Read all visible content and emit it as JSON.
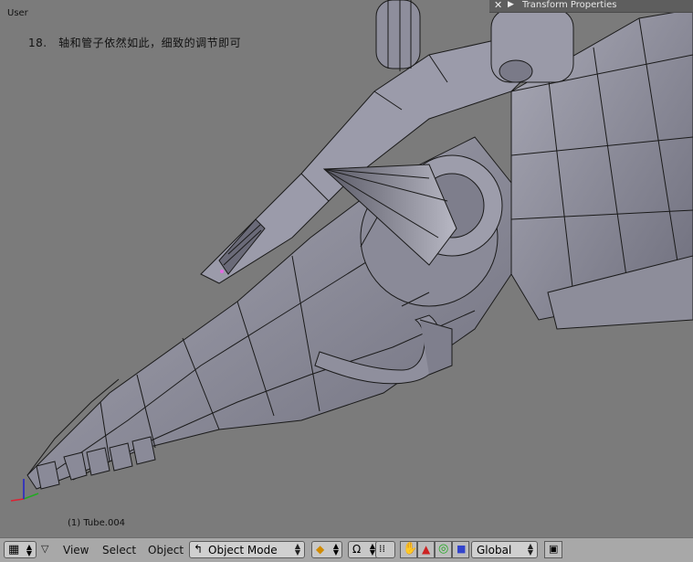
{
  "viewport": {
    "view_label": "User",
    "caption": "18.　轴和管子依然如此，细致的调节即可",
    "object_info": "(1) Tube.004"
  },
  "transform_panel": {
    "title": "Transform Properties",
    "close_icon": "close-icon",
    "collapse_icon": "triangle-right-icon"
  },
  "header": {
    "menus": [
      "View",
      "Select",
      "Object"
    ],
    "mode": "Object Mode",
    "orientation": "Global",
    "icons": [
      "grid-view-icon",
      "chevron-down-icon",
      "mode-icon",
      "shading-icon",
      "pivot-icon",
      "snap-icon",
      "hand-icon",
      "translate-icon",
      "rotate-icon",
      "scale-icon",
      "render-icon"
    ]
  },
  "colors": {
    "viewport_bg": "#7b7b7b",
    "header_bg": "#a8a8a8",
    "panel_header_bg": "#5e5e5e",
    "mesh_edge": "#1a1a1a"
  }
}
